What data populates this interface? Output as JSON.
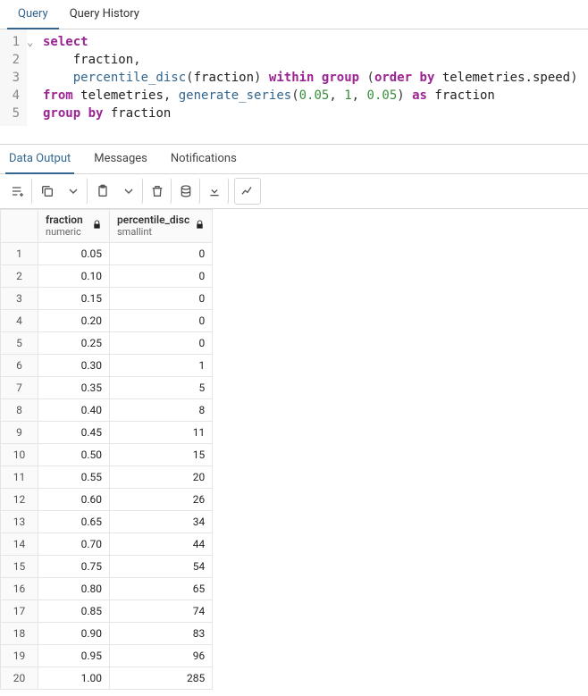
{
  "top_tabs": {
    "query": "Query",
    "history": "Query History"
  },
  "editor": {
    "lines": [
      "select",
      "    fraction,",
      "    percentile_disc(fraction) within group (order by telemetries.speed)",
      "from telemetries, generate_series(0.05, 1, 0.05) as fraction",
      "group by fraction"
    ]
  },
  "result_tabs": {
    "data": "Data Output",
    "messages": "Messages",
    "notifications": "Notifications"
  },
  "columns": [
    {
      "name": "fraction",
      "type": "numeric"
    },
    {
      "name": "percentile_disc",
      "type": "smallint"
    }
  ],
  "rows": [
    {
      "n": "1",
      "fraction": "0.05",
      "percentile_disc": "0"
    },
    {
      "n": "2",
      "fraction": "0.10",
      "percentile_disc": "0"
    },
    {
      "n": "3",
      "fraction": "0.15",
      "percentile_disc": "0"
    },
    {
      "n": "4",
      "fraction": "0.20",
      "percentile_disc": "0"
    },
    {
      "n": "5",
      "fraction": "0.25",
      "percentile_disc": "0"
    },
    {
      "n": "6",
      "fraction": "0.30",
      "percentile_disc": "1"
    },
    {
      "n": "7",
      "fraction": "0.35",
      "percentile_disc": "5"
    },
    {
      "n": "8",
      "fraction": "0.40",
      "percentile_disc": "8"
    },
    {
      "n": "9",
      "fraction": "0.45",
      "percentile_disc": "11"
    },
    {
      "n": "10",
      "fraction": "0.50",
      "percentile_disc": "15"
    },
    {
      "n": "11",
      "fraction": "0.55",
      "percentile_disc": "20"
    },
    {
      "n": "12",
      "fraction": "0.60",
      "percentile_disc": "26"
    },
    {
      "n": "13",
      "fraction": "0.65",
      "percentile_disc": "34"
    },
    {
      "n": "14",
      "fraction": "0.70",
      "percentile_disc": "44"
    },
    {
      "n": "15",
      "fraction": "0.75",
      "percentile_disc": "54"
    },
    {
      "n": "16",
      "fraction": "0.80",
      "percentile_disc": "65"
    },
    {
      "n": "17",
      "fraction": "0.85",
      "percentile_disc": "74"
    },
    {
      "n": "18",
      "fraction": "0.90",
      "percentile_disc": "83"
    },
    {
      "n": "19",
      "fraction": "0.95",
      "percentile_disc": "96"
    },
    {
      "n": "20",
      "fraction": "1.00",
      "percentile_disc": "285"
    }
  ]
}
